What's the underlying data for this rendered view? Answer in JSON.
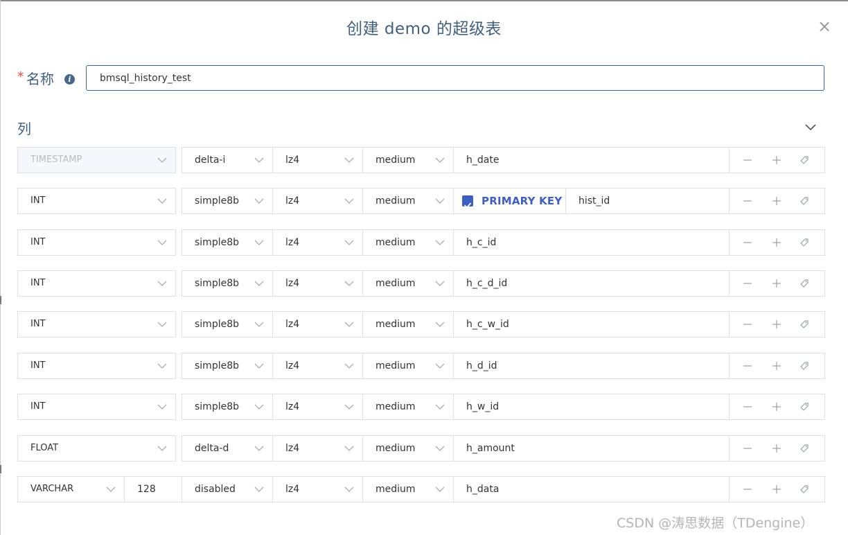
{
  "dialog": {
    "title": "创建 demo 的超级表"
  },
  "name_field": {
    "required_mark": "*",
    "label": "名称",
    "value": "bmsql_history_test"
  },
  "columns_section": {
    "title": "列"
  },
  "rows": [
    {
      "type": "TIMESTAMP",
      "encoding": "delta-i",
      "compression": "lz4",
      "level": "medium",
      "name": "h_date",
      "type_disabled": true
    },
    {
      "type": "INT",
      "encoding": "simple8b",
      "compression": "lz4",
      "level": "medium",
      "name": "hist_id",
      "primary_key": true,
      "primary_key_label": "PRIMARY KEY"
    },
    {
      "type": "INT",
      "encoding": "simple8b",
      "compression": "lz4",
      "level": "medium",
      "name": "h_c_id"
    },
    {
      "type": "INT",
      "encoding": "simple8b",
      "compression": "lz4",
      "level": "medium",
      "name": "h_c_d_id"
    },
    {
      "type": "INT",
      "encoding": "simple8b",
      "compression": "lz4",
      "level": "medium",
      "name": "h_c_w_id"
    },
    {
      "type": "INT",
      "encoding": "simple8b",
      "compression": "lz4",
      "level": "medium",
      "name": "h_d_id"
    },
    {
      "type": "INT",
      "encoding": "simple8b",
      "compression": "lz4",
      "level": "medium",
      "name": "h_w_id"
    },
    {
      "type": "FLOAT",
      "encoding": "delta-d",
      "compression": "lz4",
      "level": "medium",
      "name": "h_amount"
    },
    {
      "type": "VARCHAR",
      "length": "128",
      "encoding": "disabled",
      "compression": "lz4",
      "level": "medium",
      "name": "h_data"
    }
  ],
  "watermark": "CSDN @涛思数据（TDengine）",
  "colors": {
    "accent": "#41607f",
    "primary": "#3f5ec3",
    "border": "#dcdfe6",
    "required": "#e74c3c"
  },
  "icons": {
    "close": "close-icon",
    "info": "info-icon",
    "collapse": "chevron-down-icon",
    "remove": "minus-icon",
    "add": "plus-icon",
    "tag": "tag-icon"
  }
}
